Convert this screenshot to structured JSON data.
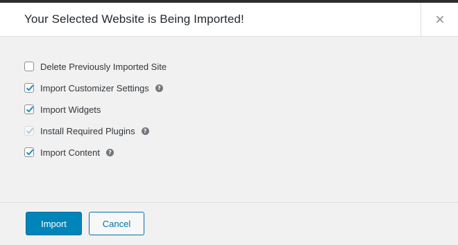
{
  "dialog": {
    "title": "Your Selected Website is Being Imported!",
    "close_label": "×"
  },
  "options": [
    {
      "label": "Delete Previously Imported Site",
      "checked": false,
      "disabled": false,
      "help": false
    },
    {
      "label": "Import Customizer Settings",
      "checked": true,
      "disabled": false,
      "help": true
    },
    {
      "label": "Import Widgets",
      "checked": true,
      "disabled": false,
      "help": false
    },
    {
      "label": "Install Required Plugins",
      "checked": true,
      "disabled": true,
      "help": true
    },
    {
      "label": "Import Content",
      "checked": true,
      "disabled": false,
      "help": true
    }
  ],
  "help_glyph": "?",
  "footer": {
    "import_label": "Import",
    "cancel_label": "Cancel"
  },
  "colors": {
    "primary": "#0085ba",
    "check": "#1e8cbe",
    "check_disabled": "#a7cbe0"
  }
}
